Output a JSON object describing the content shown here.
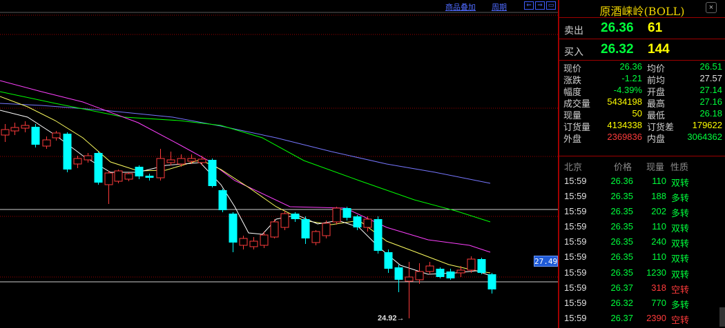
{
  "toolbar": {
    "overlay_label": "商品叠加",
    "period_label": "周期",
    "nav_left": "⇐",
    "nav_right": "⇒",
    "nav_max": "▭"
  },
  "chart": {
    "last_price_tag": "27.49",
    "low_marker": "24.92→",
    "colors": {
      "up": "#ff3b3b",
      "down": "#00ffff",
      "ma_white": "#ffffff",
      "ma_yellow": "#ffff60",
      "ma_magenta": "#ff40ff",
      "ma_green": "#00ff00",
      "ma_blue": "#7777ff",
      "grid": "#a00000"
    }
  },
  "side": {
    "title": "原酒崃岭(BOLL)",
    "close_label": "×",
    "sell": {
      "label": "卖出",
      "price": "26.36",
      "volume": "61"
    },
    "buy": {
      "label": "买入",
      "price": "26.32",
      "volume": "144"
    },
    "stats": [
      {
        "l1": "现价",
        "v1": "26.36",
        "c1": "#00ff3c",
        "l2": "均价",
        "v2": "26.51",
        "c2": "#00ff3c"
      },
      {
        "l1": "涨跌",
        "v1": "-1.21",
        "c1": "#00ff3c",
        "l2": "前均",
        "v2": "27.57",
        "c2": "#e0e0e0"
      },
      {
        "l1": "幅度",
        "v1": "-4.39%",
        "c1": "#00ff3c",
        "l2": "开盘",
        "v2": "27.14",
        "c2": "#00ff3c"
      },
      {
        "l1": "成交量",
        "v1": "5434198",
        "c1": "#ffff00",
        "l2": "最高",
        "v2": "27.16",
        "c2": "#00ff3c"
      },
      {
        "l1": "现量",
        "v1": "50",
        "c1": "#ffff00",
        "l2": "最低",
        "v2": "26.18",
        "c2": "#00ff3c"
      },
      {
        "l1": "订货量",
        "v1": "4134338",
        "c1": "#ffff00",
        "l2": "订货差",
        "v2": "179622",
        "c2": "#ffff00"
      },
      {
        "l1": "外盘",
        "v1": "2369836",
        "c1": "#ff3b3b",
        "l2": "内盘",
        "v2": "3064362",
        "c2": "#00ff3c"
      }
    ],
    "tick_header": {
      "time": "北京",
      "price": "价格",
      "volume": "现量",
      "nature": "性质"
    },
    "ticks": [
      {
        "time": "15:59",
        "price": "26.36",
        "volume": "110",
        "vcolor": "#00ff3c",
        "nature": "双转",
        "ncolor": "#00ff3c"
      },
      {
        "time": "15:59",
        "price": "26.35",
        "volume": "188",
        "vcolor": "#00ff3c",
        "nature": "多转",
        "ncolor": "#00ff3c"
      },
      {
        "time": "15:59",
        "price": "26.35",
        "volume": "202",
        "vcolor": "#00ff3c",
        "nature": "多转",
        "ncolor": "#00ff3c"
      },
      {
        "time": "15:59",
        "price": "26.35",
        "volume": "110",
        "vcolor": "#00ff3c",
        "nature": "双转",
        "ncolor": "#00ff3c"
      },
      {
        "time": "15:59",
        "price": "26.35",
        "volume": "240",
        "vcolor": "#00ff3c",
        "nature": "双转",
        "ncolor": "#00ff3c"
      },
      {
        "time": "15:59",
        "price": "26.35",
        "volume": "110",
        "vcolor": "#00ff3c",
        "nature": "双转",
        "ncolor": "#00ff3c"
      },
      {
        "time": "15:59",
        "price": "26.35",
        "volume": "1230",
        "vcolor": "#00ff3c",
        "nature": "双转",
        "ncolor": "#00ff3c"
      },
      {
        "time": "15:59",
        "price": "26.37",
        "volume": "318",
        "vcolor": "#ff3b3b",
        "nature": "空转",
        "ncolor": "#ff3b3b"
      },
      {
        "time": "15:59",
        "price": "26.32",
        "volume": "770",
        "vcolor": "#00ff3c",
        "nature": "多转",
        "ncolor": "#00ff3c"
      },
      {
        "time": "15:59",
        "price": "26.37",
        "volume": "2390",
        "vcolor": "#ff3b3b",
        "nature": "空转",
        "ncolor": "#ff3b3b"
      }
    ]
  }
}
